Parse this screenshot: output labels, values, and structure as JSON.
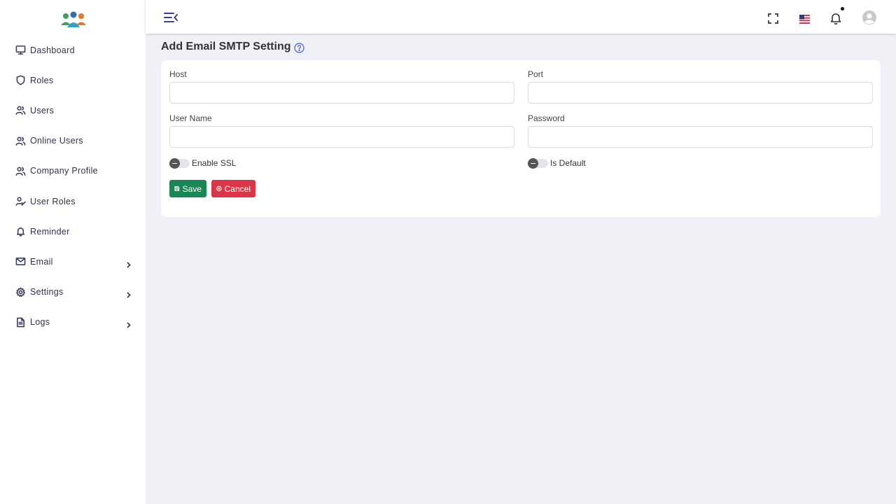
{
  "sidebar": {
    "items": [
      {
        "label": "Dashboard",
        "icon": "monitor-icon"
      },
      {
        "label": "Roles",
        "icon": "shield-icon"
      },
      {
        "label": "Users",
        "icon": "users-icon"
      },
      {
        "label": "Online Users",
        "icon": "users-icon"
      },
      {
        "label": "Company Profile",
        "icon": "users-icon"
      },
      {
        "label": "User Roles",
        "icon": "user-check-icon"
      },
      {
        "label": "Reminder",
        "icon": "bell-icon"
      },
      {
        "label": "Email",
        "icon": "mail-icon",
        "submenu": true
      },
      {
        "label": "Settings",
        "icon": "gear-icon",
        "submenu": true
      },
      {
        "label": "Logs",
        "icon": "file-icon",
        "submenu": true
      }
    ]
  },
  "topbar": {
    "icons": [
      "menu-toggle-icon",
      "fullscreen-icon",
      "us-flag-icon",
      "bell-icon",
      "avatar"
    ]
  },
  "page": {
    "title": "Add Email SMTP Setting"
  },
  "form": {
    "host_label": "Host",
    "host_value": "",
    "port_label": "Port",
    "port_value": "",
    "username_label": "User Name",
    "username_value": "",
    "password_label": "Password",
    "password_value": "",
    "enable_ssl_label": "Enable SSL",
    "enable_ssl_on": false,
    "is_default_label": "Is Default",
    "is_default_on": false,
    "save_label": "Save",
    "cancel_label": "Cancel"
  },
  "colors": {
    "accent": "#3b3f8f",
    "save": "#198754",
    "cancel": "#dc3545",
    "background": "#f0f1f7"
  }
}
